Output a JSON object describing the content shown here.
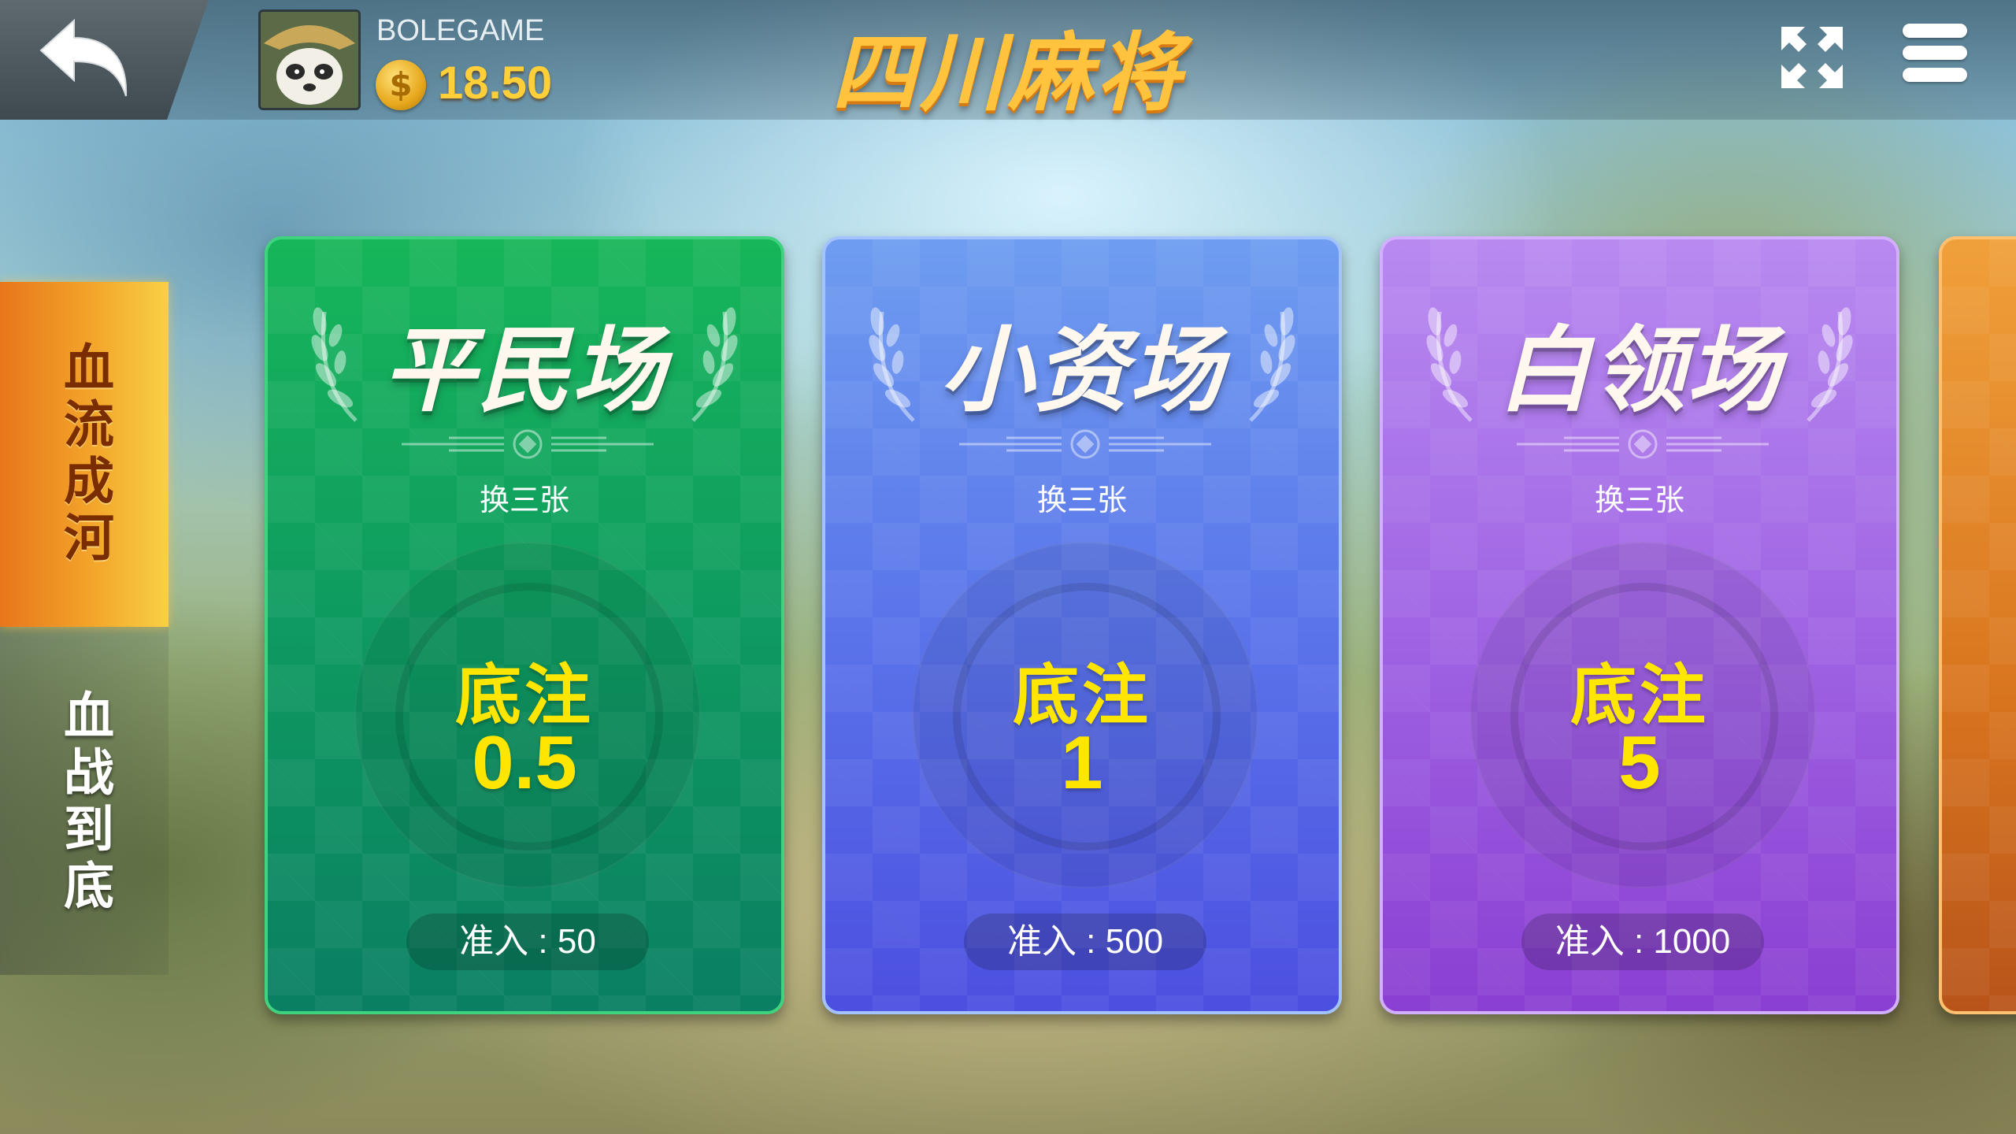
{
  "header": {
    "username": "BOLEGAME",
    "coins": "18.50",
    "title": "四川麻将"
  },
  "modes": [
    {
      "label": "血流成河",
      "active": true
    },
    {
      "label": "血战到底",
      "active": false
    }
  ],
  "rooms": [
    {
      "name": "平民场",
      "rule": "换三张",
      "bet_label": "底注",
      "bet": "0.5",
      "entry": "准入 : 50",
      "color": "#13a85e"
    },
    {
      "name": "小资场",
      "rule": "换三张",
      "bet_label": "底注",
      "bet": "1",
      "entry": "准入 : 500",
      "color": "#5a74ea"
    },
    {
      "name": "白领场",
      "rule": "换三张",
      "bet_label": "底注",
      "bet": "5",
      "entry": "准入 : 1000",
      "color": "#a064e4"
    }
  ],
  "icons": {
    "back": "back-arrow-icon",
    "coin": "coin-icon",
    "fullscreen": "fullscreen-icon",
    "menu": "hamburger-menu-icon"
  },
  "colors": {
    "accent_gold": "#ffc33d",
    "bet_yellow": "#ffe600",
    "active_tab": "#f3a52a"
  }
}
